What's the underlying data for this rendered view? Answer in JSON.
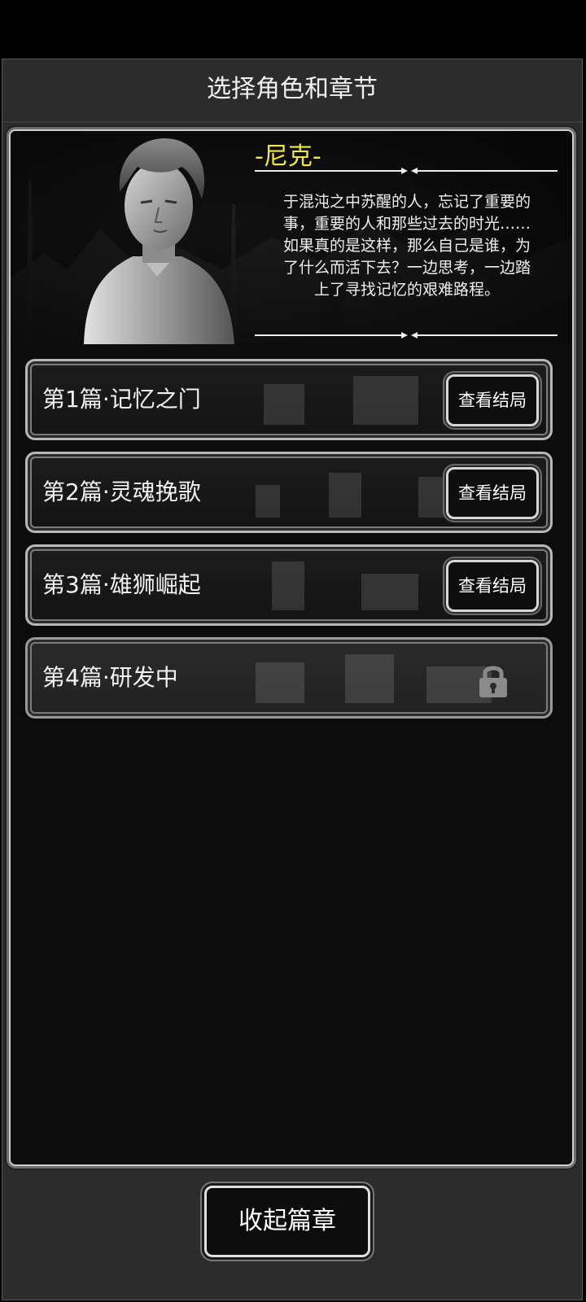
{
  "dialog": {
    "title": "选择角色和章节"
  },
  "character": {
    "name": "-尼克-",
    "bio_lines": [
      "于混沌之中苏醒的人，忘记了重要的",
      "事，重要的人和那些过去的时光……",
      "如果真的是这样，那么自己是谁，为",
      "了什么而活下去？一边思考，一边踏",
      "上了寻找记忆的艰难路程。"
    ]
  },
  "chapters": [
    {
      "label": "第1篇·记忆之门",
      "button": "查看结局",
      "locked": false
    },
    {
      "label": "第2篇·灵魂挽歌",
      "button": "查看结局",
      "locked": false
    },
    {
      "label": "第3篇·雄狮崛起",
      "button": "查看结局",
      "locked": false
    },
    {
      "label": "第4篇·研发中",
      "button": "",
      "locked": true,
      "icon": "lock-icon"
    }
  ],
  "footer": {
    "collapse_label": "收起篇章"
  },
  "colors": {
    "name_accent": "#f4e63a",
    "panel_bg": "#0c0c0c",
    "dialog_bg": "#2c2c2c"
  }
}
